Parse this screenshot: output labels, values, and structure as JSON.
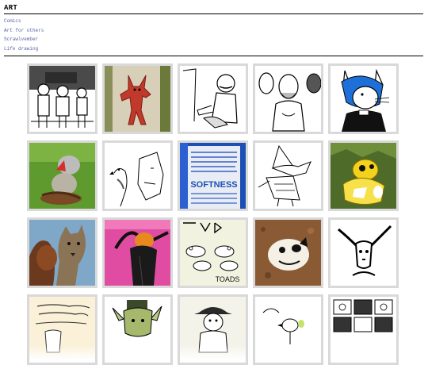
{
  "page": {
    "title": "ART"
  },
  "nav": {
    "items": [
      {
        "label": "Comics"
      },
      {
        "label": "Art for others"
      },
      {
        "label": "Scrawlvember"
      },
      {
        "label": "Life drawing"
      }
    ]
  },
  "gallery": {
    "tiles": [
      {
        "icon": "comic-figures-thumbnail"
      },
      {
        "icon": "red-creature-painting-thumbnail"
      },
      {
        "icon": "mustached-man-drawing-thumbnail"
      },
      {
        "icon": "bearded-figure-drawing-thumbnail"
      },
      {
        "icon": "blue-haired-mouse-drawing-thumbnail"
      },
      {
        "icon": "clay-figure-on-grass-thumbnail"
      },
      {
        "icon": "bird-and-face-sketch-thumbnail"
      },
      {
        "icon": "softness-label-can-thumbnail",
        "text": "SOFTNESS"
      },
      {
        "icon": "wizard-dog-sketch-thumbnail"
      },
      {
        "icon": "yellow-plush-toy-thumbnail"
      },
      {
        "icon": "two-animals-painting-thumbnail"
      },
      {
        "icon": "figure-on-pink-thumbnail"
      },
      {
        "icon": "toads-sketch-thumbnail",
        "text": "TOADS"
      },
      {
        "icon": "painted-rock-face-thumbnail"
      },
      {
        "icon": "long-eared-creature-drawing-thumbnail"
      },
      {
        "icon": "handwritten-comic-thumbnail"
      },
      {
        "icon": "green-creature-with-hat-thumbnail"
      },
      {
        "icon": "hat-figure-sketch-thumbnail"
      },
      {
        "icon": "small-bird-sketch-thumbnail"
      },
      {
        "icon": "comic-grid-thumbnail"
      }
    ]
  },
  "colors": {
    "link": "#5a64a8",
    "tile_border": "#d9d9d9"
  }
}
